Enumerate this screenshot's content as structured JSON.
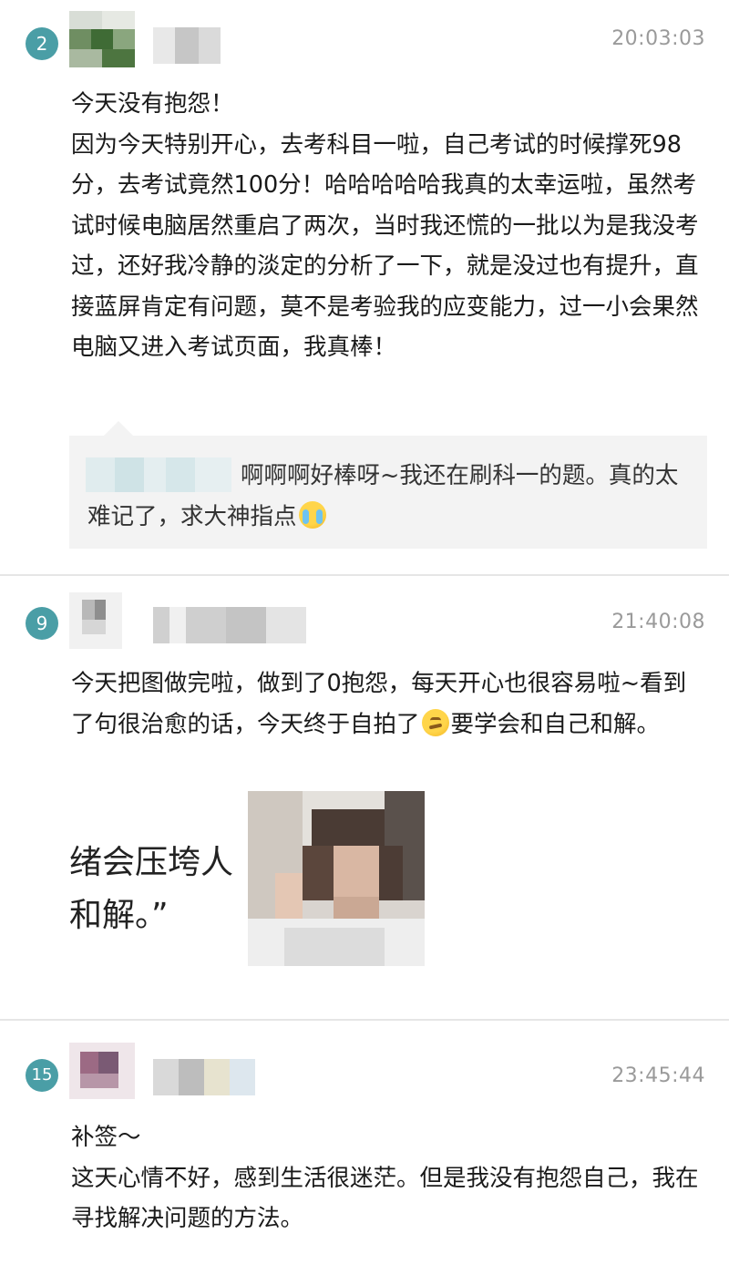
{
  "posts": [
    {
      "floor": "2",
      "time": "20:03:03",
      "body": "今天没有抱怨！\n因为今天特别开心，去考科目一啦，自己考试的时候撑死98分，去考试竟然100分！哈哈哈哈哈我真的太幸运啦，虽然考试时候电脑居然重启了两次，当时我还慌的一批以为是我没考过，还好我冷静的淡定的分析了一下，就是没过也有提升，直接蓝屏肯定有问题，莫不是考验我的应变能力，过一小会果然电脑又进入考试页面，我真棒！",
      "reply": {
        "text": "啊啊啊好棒呀~我还在刷科一的题。真的太难记了，求大神指点",
        "emoji": "crying-face"
      }
    },
    {
      "floor": "9",
      "time": "21:40:08",
      "body_part1": "今天把图做完啦，做到了0抱怨，每天开心也很容易啦~看到了句很治愈的话，今天终于自拍了",
      "emoji": "thinking-face",
      "body_part2": "要学会和自己和解。",
      "photo_quote": "绪会压垮人\n和解。”"
    },
    {
      "floor": "15",
      "time": "23:45:44",
      "body": "补签～\n这天心情不好，感到生活很迷茫。但是我没有抱怨自己，我在寻找解决问题的方法。"
    }
  ],
  "colors": {
    "badge": "#4a9ea6",
    "timestamp": "#9a9a9a",
    "reply_bg": "#f3f3f3",
    "divider": "#e6e6e6"
  }
}
